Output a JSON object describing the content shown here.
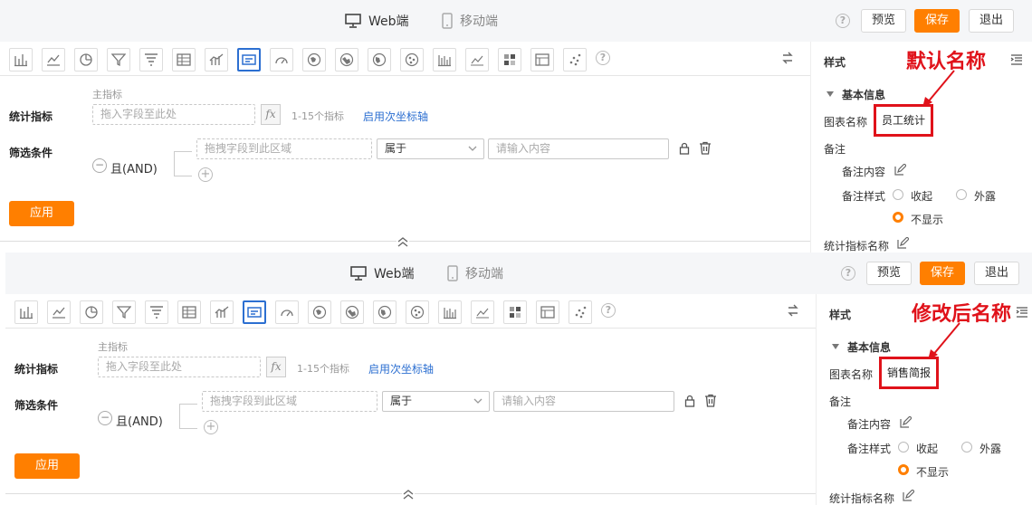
{
  "colors": {
    "accent": "#ff7f00",
    "link": "#2c6fd1",
    "annotation": "#e0121a"
  },
  "header": {
    "web_tab": "Web端",
    "mobile_tab": "移动端",
    "preview": "预览",
    "save": "保存",
    "exit": "退出"
  },
  "toolbar": {
    "icons": [
      "bar-chart-icon",
      "line-chart-icon",
      "pie-chart-icon",
      "funnel-icon",
      "funnel-alt-icon",
      "table-icon",
      "combo-chart-icon",
      "indicator-card-icon",
      "gauge-icon",
      "china-map-icon",
      "globe-map-icon",
      "world-map-icon",
      "scatter-map-icon",
      "column-chart-icon",
      "area-chart-icon",
      "heatmap-icon",
      "detail-table-icon",
      "scatter-icon"
    ],
    "active_index": 7
  },
  "form": {
    "sub_label": "主指标",
    "metric_label": "统计指标",
    "metric_placeholder": "拖入字段至此处",
    "fx": "fx",
    "range_hint": "1-15个指标",
    "secondary_axis": "启用次坐标轴",
    "filter_label": "筛选条件",
    "and_label": "且(AND)",
    "filter_field_placeholder": "拖拽字段到此区域",
    "operator": "属于",
    "value_placeholder": "请输入内容",
    "apply": "应用"
  },
  "sidebar": {
    "title": "样式",
    "section": "基本信息",
    "chart_name_label": "图表名称",
    "remark": "备注",
    "remark_content": "备注内容",
    "remark_style": "备注样式",
    "opt_collapse": "收起",
    "opt_expose": "外露",
    "opt_hide": "不显示",
    "metric_name": "统计指标名称"
  },
  "panels": [
    {
      "chart_name": "员工统计",
      "annotation": "默认名称"
    },
    {
      "chart_name": "销售简报",
      "annotation": "修改后名称"
    }
  ]
}
